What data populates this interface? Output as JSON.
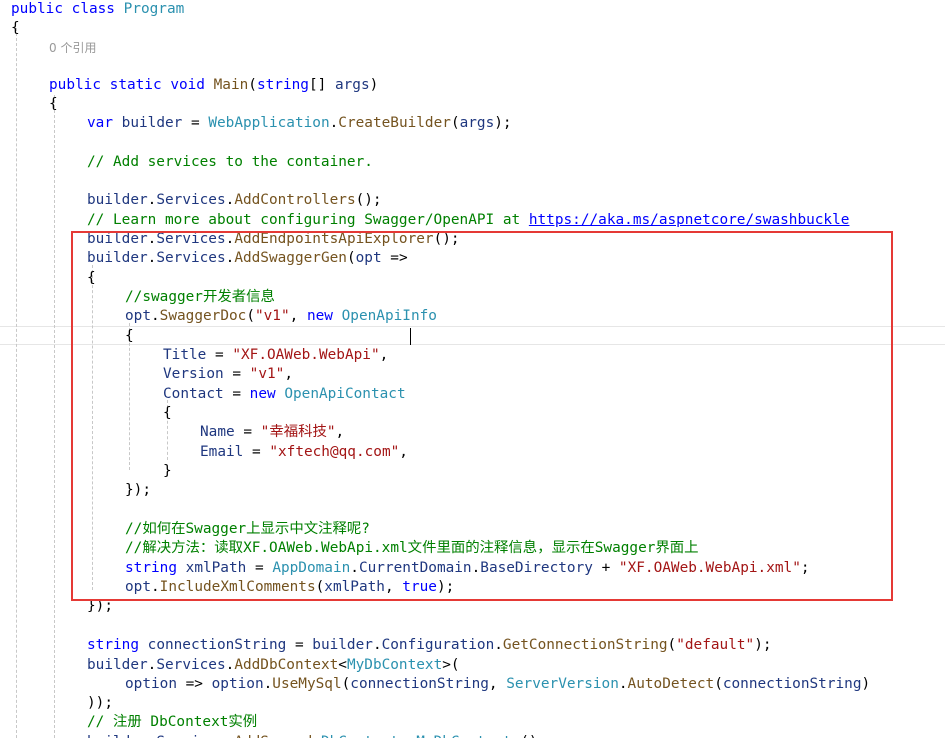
{
  "editor": {
    "codelens": "0 个引用",
    "highlight_color": "#e53935",
    "lines": [
      [
        [
          "k",
          "public"
        ],
        [
          "p",
          " "
        ],
        [
          "k",
          "class"
        ],
        [
          "p",
          " "
        ],
        [
          "t",
          "Program"
        ]
      ],
      [
        [
          "p",
          "{"
        ]
      ],
      [
        [
          "k",
          "public"
        ],
        [
          "p",
          " "
        ],
        [
          "k",
          "static"
        ],
        [
          "p",
          " "
        ],
        [
          "k",
          "void"
        ],
        [
          "p",
          " "
        ],
        [
          "f",
          "Main"
        ],
        [
          "p",
          "("
        ],
        [
          "k",
          "string"
        ],
        [
          "p",
          "[] "
        ],
        [
          "v",
          "args"
        ],
        [
          "p",
          ")"
        ]
      ],
      [
        [
          "p",
          "{"
        ]
      ],
      [
        [
          "k",
          "var"
        ],
        [
          "p",
          " "
        ],
        [
          "v",
          "builder"
        ],
        [
          "p",
          " = "
        ],
        [
          "t",
          "WebApplication"
        ],
        [
          "p",
          "."
        ],
        [
          "f",
          "CreateBuilder"
        ],
        [
          "p",
          "("
        ],
        [
          "v",
          "args"
        ],
        [
          "p",
          ");"
        ]
      ],
      [],
      [
        [
          "c",
          "// Add services to the container."
        ]
      ],
      [],
      [
        [
          "v",
          "builder"
        ],
        [
          "p",
          "."
        ],
        [
          "v",
          "Services"
        ],
        [
          "p",
          "."
        ],
        [
          "f",
          "AddControllers"
        ],
        [
          "p",
          "();"
        ]
      ],
      [
        [
          "c",
          "// Learn more about configuring Swagger/OpenAPI at "
        ],
        [
          "u",
          "https://aka.ms/aspnetcore/swashbuckle"
        ]
      ],
      [
        [
          "v",
          "builder"
        ],
        [
          "p",
          "."
        ],
        [
          "v",
          "Services"
        ],
        [
          "p",
          "."
        ],
        [
          "f",
          "AddEndpointsApiExplorer"
        ],
        [
          "p",
          "();"
        ]
      ],
      [
        [
          "v",
          "builder"
        ],
        [
          "p",
          "."
        ],
        [
          "v",
          "Services"
        ],
        [
          "p",
          "."
        ],
        [
          "f",
          "AddSwaggerGen"
        ],
        [
          "p",
          "("
        ],
        [
          "v",
          "opt"
        ],
        [
          "p",
          " =>"
        ]
      ],
      [
        [
          "p",
          "{"
        ]
      ],
      [
        [
          "c",
          "//swagger开发者信息"
        ]
      ],
      [
        [
          "v",
          "opt"
        ],
        [
          "p",
          "."
        ],
        [
          "f",
          "SwaggerDoc"
        ],
        [
          "p",
          "("
        ],
        [
          "s",
          "\"v1\""
        ],
        [
          "p",
          ", "
        ],
        [
          "k",
          "new"
        ],
        [
          "p",
          " "
        ],
        [
          "t",
          "OpenApiInfo"
        ]
      ],
      [
        [
          "p",
          "{"
        ]
      ],
      [
        [
          "v",
          "Title"
        ],
        [
          "p",
          " = "
        ],
        [
          "s",
          "\"XF.OAWeb.WebApi\""
        ],
        [
          "p",
          ","
        ]
      ],
      [
        [
          "v",
          "Version"
        ],
        [
          "p",
          " = "
        ],
        [
          "s",
          "\"v1\""
        ],
        [
          "p",
          ","
        ]
      ],
      [
        [
          "v",
          "Contact"
        ],
        [
          "p",
          " = "
        ],
        [
          "k",
          "new"
        ],
        [
          "p",
          " "
        ],
        [
          "t",
          "OpenApiContact"
        ]
      ],
      [
        [
          "p",
          "{"
        ]
      ],
      [
        [
          "v",
          "Name"
        ],
        [
          "p",
          " = "
        ],
        [
          "s",
          "\"幸福科技\""
        ],
        [
          "p",
          ","
        ]
      ],
      [
        [
          "v",
          "Email"
        ],
        [
          "p",
          " = "
        ],
        [
          "s",
          "\"xftech@qq.com\""
        ],
        [
          "p",
          ","
        ]
      ],
      [
        [
          "p",
          "}"
        ]
      ],
      [
        [
          "p",
          "});"
        ]
      ],
      [],
      [
        [
          "c",
          "//如何在Swagger上显示中文注释呢?"
        ]
      ],
      [
        [
          "c",
          "//解决方法：读取XF.OAWeb.WebApi.xml文件里面的注释信息，显示在Swagger界面上"
        ]
      ],
      [
        [
          "k",
          "string"
        ],
        [
          "p",
          " "
        ],
        [
          "v",
          "xmlPath"
        ],
        [
          "p",
          " = "
        ],
        [
          "t",
          "AppDomain"
        ],
        [
          "p",
          "."
        ],
        [
          "v",
          "CurrentDomain"
        ],
        [
          "p",
          "."
        ],
        [
          "v",
          "BaseDirectory"
        ],
        [
          "p",
          " + "
        ],
        [
          "s",
          "\"XF.OAWeb.WebApi.xml\""
        ],
        [
          "p",
          ";"
        ]
      ],
      [
        [
          "v",
          "opt"
        ],
        [
          "p",
          "."
        ],
        [
          "f",
          "IncludeXmlComments"
        ],
        [
          "p",
          "("
        ],
        [
          "v",
          "xmlPath"
        ],
        [
          "p",
          ", "
        ],
        [
          "k",
          "true"
        ],
        [
          "p",
          ");"
        ]
      ],
      [
        [
          "p",
          "});"
        ]
      ],
      [],
      [
        [
          "k",
          "string"
        ],
        [
          "p",
          " "
        ],
        [
          "v",
          "connectionString"
        ],
        [
          "p",
          " = "
        ],
        [
          "v",
          "builder"
        ],
        [
          "p",
          "."
        ],
        [
          "v",
          "Configuration"
        ],
        [
          "p",
          "."
        ],
        [
          "f",
          "GetConnectionString"
        ],
        [
          "p",
          "("
        ],
        [
          "s",
          "\"default\""
        ],
        [
          "p",
          ");"
        ]
      ],
      [
        [
          "v",
          "builder"
        ],
        [
          "p",
          "."
        ],
        [
          "v",
          "Services"
        ],
        [
          "p",
          "."
        ],
        [
          "f",
          "AddDbContext"
        ],
        [
          "p",
          "<"
        ],
        [
          "t",
          "MyDbContext"
        ],
        [
          "p",
          ">("
        ]
      ],
      [
        [
          "v",
          "option"
        ],
        [
          "p",
          " => "
        ],
        [
          "v",
          "option"
        ],
        [
          "p",
          "."
        ],
        [
          "f",
          "UseMySql"
        ],
        [
          "p",
          "("
        ],
        [
          "v",
          "connectionString"
        ],
        [
          "p",
          ", "
        ],
        [
          "t",
          "ServerVersion"
        ],
        [
          "p",
          "."
        ],
        [
          "f",
          "AutoDetect"
        ],
        [
          "p",
          "("
        ],
        [
          "v",
          "connectionString"
        ],
        [
          "p",
          ")"
        ]
      ],
      [
        [
          "p",
          "));"
        ]
      ],
      [
        [
          "c",
          "// 注册 DbContext实例"
        ]
      ],
      [
        [
          "v",
          "builder"
        ],
        [
          "p",
          "."
        ],
        [
          "v",
          "Services"
        ],
        [
          "p",
          "."
        ],
        [
          "f",
          "AddScoped"
        ],
        [
          "p",
          "<"
        ],
        [
          "t",
          "DbContext"
        ],
        [
          "p",
          ", "
        ],
        [
          "t",
          "MyDbContext"
        ],
        [
          "p",
          ">();"
        ]
      ]
    ]
  }
}
